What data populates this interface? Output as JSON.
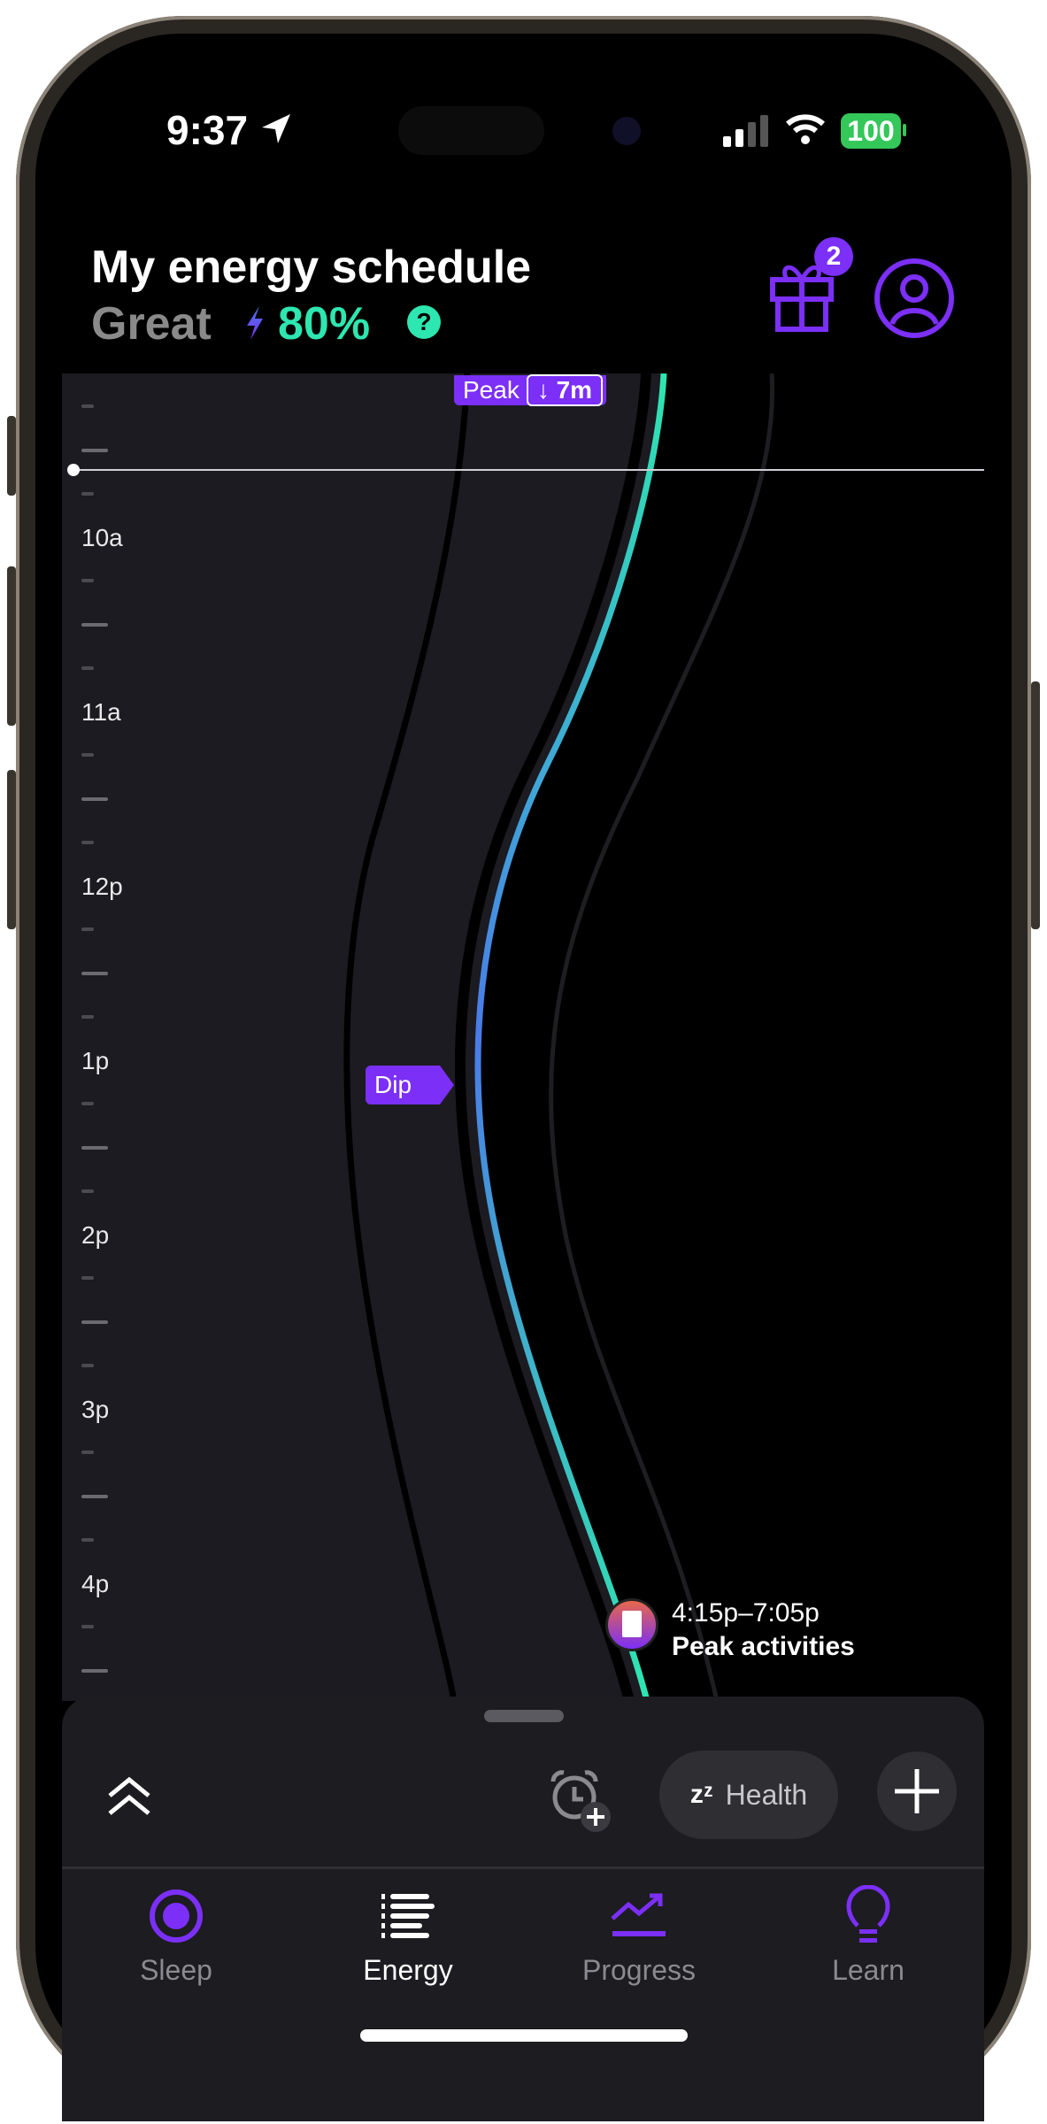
{
  "status_bar": {
    "time": "9:37",
    "battery": "100",
    "icons": [
      "location-arrow-icon",
      "signal-icon",
      "wifi-icon",
      "battery-icon"
    ]
  },
  "header": {
    "title": "My energy schedule",
    "rating": "Great",
    "energy_percent": "80%",
    "help_icon": "?",
    "gift_badge": "2"
  },
  "chart": {
    "peak_label": "Peak",
    "peak_delta": "↓ 7m",
    "dip_label": "Dip",
    "time_labels": [
      "10a",
      "11a",
      "12p",
      "1p",
      "2p",
      "3p",
      "4p"
    ],
    "event": {
      "time_range": "4:15p–7:05p",
      "title": "Peak activities"
    }
  },
  "sheet": {
    "health_label": "Health",
    "health_icon": "zᶻ"
  },
  "tabs": [
    {
      "label": "Sleep",
      "active": false
    },
    {
      "label": "Energy",
      "active": true
    },
    {
      "label": "Progress",
      "active": false
    },
    {
      "label": "Learn",
      "active": false
    }
  ],
  "colors": {
    "accent": "#7b2ff7",
    "energy": "#2ee6b0",
    "dip_blue": "#4a7be8",
    "panel": "#1c1b21"
  }
}
